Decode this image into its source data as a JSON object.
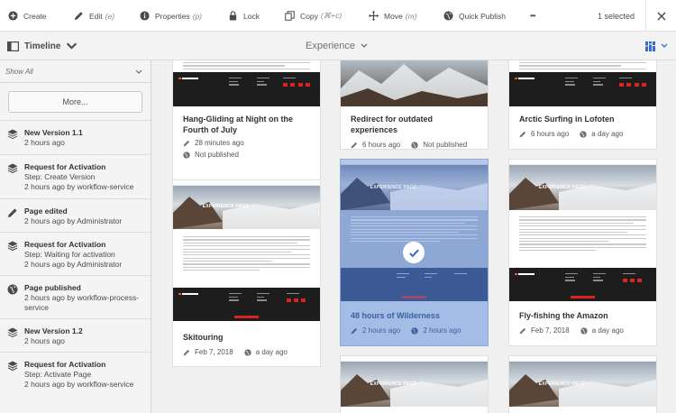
{
  "toolbar": {
    "create": "Create",
    "edit": "Edit",
    "edit_shortcut": "(e)",
    "properties": "Properties",
    "properties_shortcut": "(p)",
    "lock": "Lock",
    "copy": "Copy",
    "copy_shortcut": "(⌘+c)",
    "move": "Move",
    "move_shortcut": "(m)",
    "quick_publish": "Quick Publish",
    "more": "•••",
    "selected": "1 selected"
  },
  "subheader": {
    "rail_label": "Timeline",
    "title": "Experience"
  },
  "rail": {
    "filter": "Show All",
    "more_button": "More...",
    "items": [
      {
        "icon": "layers-icon",
        "title": "New Version 1.1",
        "lines": [
          "2 hours ago"
        ]
      },
      {
        "icon": "workflow-icon",
        "title": "Request for Activation",
        "lines": [
          "Step: Create Version",
          "2 hours ago by workflow-service"
        ]
      },
      {
        "icon": "pencil-icon",
        "title": "Page edited",
        "lines": [
          "2 hours ago by Administrator"
        ]
      },
      {
        "icon": "workflow-icon",
        "title": "Request for Activation",
        "lines": [
          "Step: Waiting for activation",
          "2 hours ago by Administrator"
        ]
      },
      {
        "icon": "globe-icon",
        "title": "Page published",
        "lines": [
          "2 hours ago by workflow-process-",
          "service"
        ]
      },
      {
        "icon": "layers-icon",
        "title": "New Version 1.2",
        "lines": [
          "2 hours ago"
        ]
      },
      {
        "icon": "workflow-icon",
        "title": "Request for Activation",
        "lines": [
          "Step: Activate Page",
          "2 hours ago by workflow-service"
        ]
      }
    ]
  },
  "thumb_text": "EXPERIENCE PAGE",
  "cards": [
    {
      "title": "Hang-Gliding at Night on the Fourth of July",
      "modified": "28 minutes ago",
      "published": "Not published"
    },
    {
      "title": "Redirect for outdated experiences",
      "modified": "6 hours ago",
      "published": "Not published"
    },
    {
      "title": "Arctic Surfing in Lofoten",
      "modified": "6 hours ago",
      "published": "a day ago"
    },
    {
      "title": "Skitouring",
      "modified": "Feb 7, 2018",
      "published": "a day ago"
    },
    {
      "title": "48 hours of Wilderness",
      "modified": "2 hours ago",
      "published": "2 hours ago"
    },
    {
      "title": "Fly-fishing the Amazon",
      "modified": "Feb 7, 2018",
      "published": "a day ago"
    }
  ],
  "colors": {
    "accent": "#326ec8",
    "selected_card": "#a4bde6",
    "thumb_red": "#d22222"
  }
}
